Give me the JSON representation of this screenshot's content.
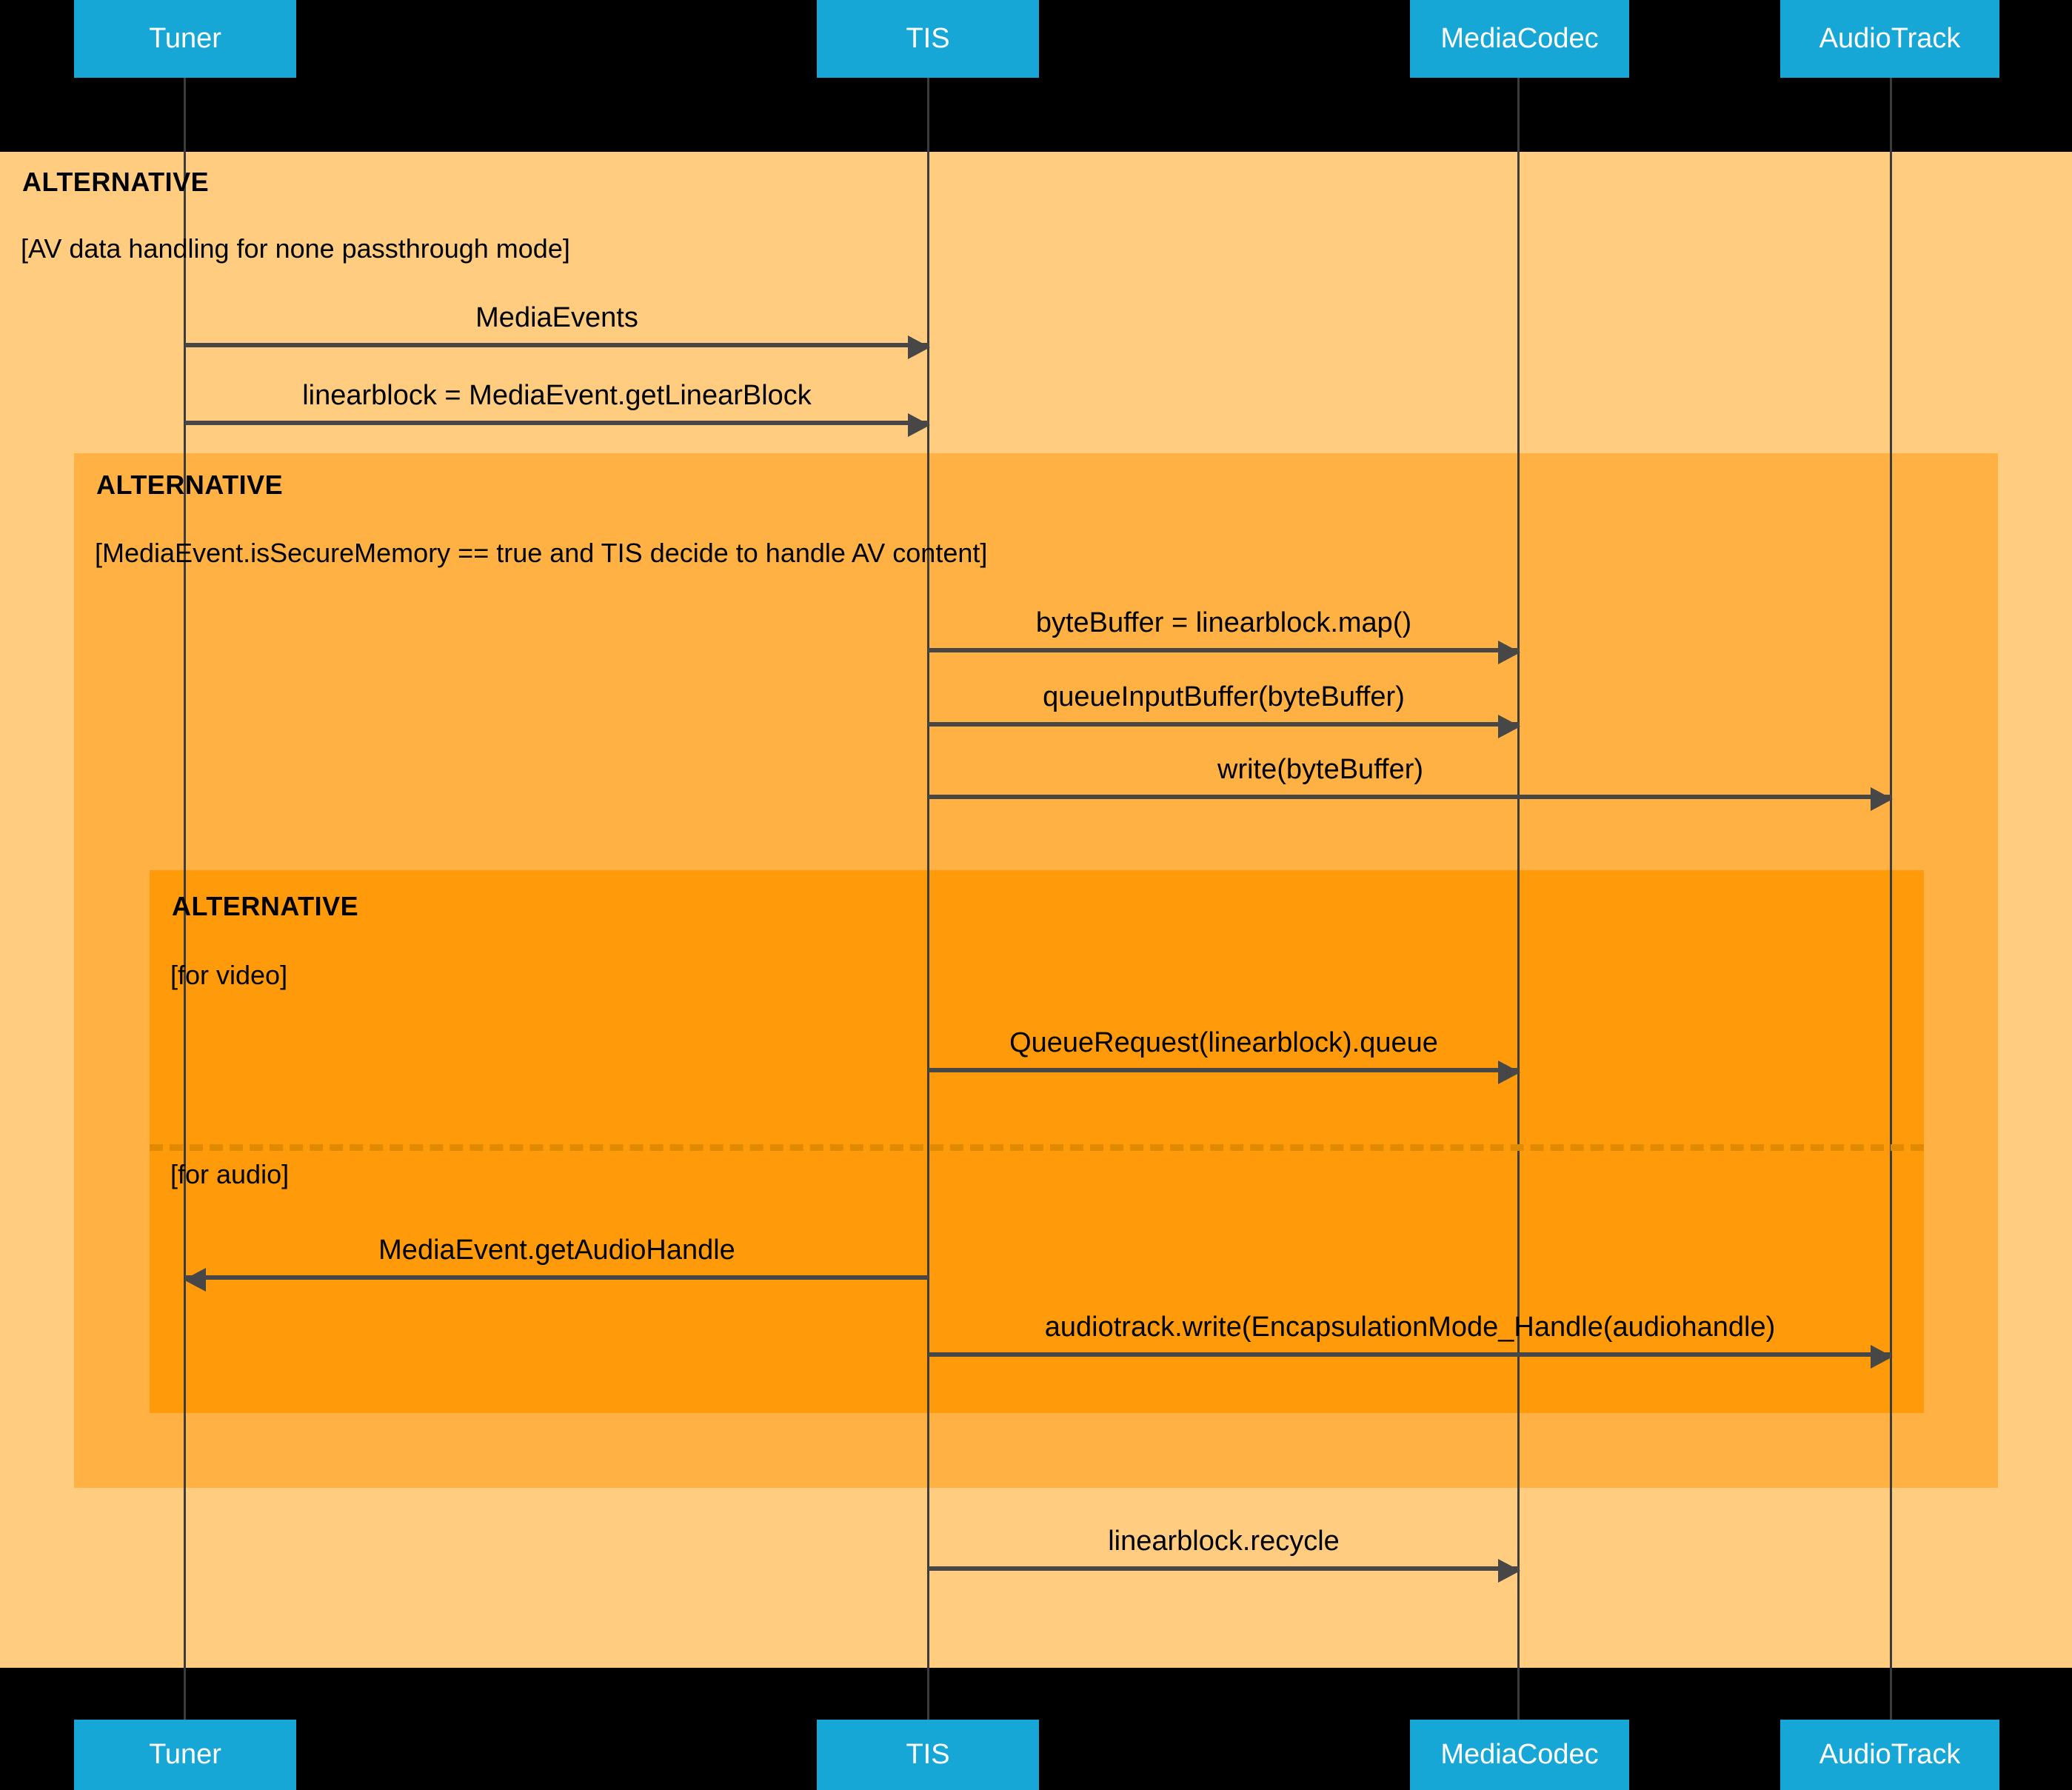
{
  "diagram": {
    "type": "uml-sequence-diagram",
    "background_color": "#000000",
    "participant_color": "#17A7D6",
    "participant_label_color": "#FFFFFF",
    "arrow_color": "#474747"
  },
  "participants": [
    {
      "name": "Tuner"
    },
    {
      "name": "TIS"
    },
    {
      "name": "MediaCodec"
    },
    {
      "name": "AudioTrack"
    }
  ],
  "fragments": {
    "outer": {
      "keyword": "ALTERNATIVE",
      "guard": "[AV data handling for none passthrough mode]",
      "fill": "#FFCC80"
    },
    "middle": {
      "keyword": "ALTERNATIVE",
      "guard": "[MediaEvent.isSecureMemory == true and TIS decide to handle AV content]",
      "fill": "#FFB143"
    },
    "inner": {
      "keyword": "ALTERNATIVE",
      "guard_video": "[for video]",
      "guard_audio": "[for audio]",
      "fill": "#FF9B0A",
      "divider": "dashed"
    }
  },
  "messages": [
    {
      "label": "MediaEvents",
      "from": "Tuner",
      "to": "TIS",
      "direction": "right"
    },
    {
      "label": "linearblock = MediaEvent.getLinearBlock",
      "from": "Tuner",
      "to": "TIS",
      "direction": "right"
    },
    {
      "label": "byteBuffer = linearblock.map()",
      "from": "TIS",
      "to": "MediaCodec",
      "direction": "right"
    },
    {
      "label": "queueInputBuffer(byteBuffer)",
      "from": "TIS",
      "to": "MediaCodec",
      "direction": "right"
    },
    {
      "label": "write(byteBuffer)",
      "from": "TIS",
      "to": "AudioTrack",
      "direction": "right"
    },
    {
      "label": "QueueRequest(linearblock).queue",
      "from": "TIS",
      "to": "MediaCodec",
      "direction": "right"
    },
    {
      "label": "MediaEvent.getAudioHandle",
      "from": "TIS",
      "to": "Tuner",
      "direction": "left"
    },
    {
      "label": "audiotrack.write(EncapsulationMode_Handle(audiohandle)",
      "from": "TIS",
      "to": "AudioTrack",
      "direction": "right"
    },
    {
      "label": "linearblock.recycle",
      "from": "TIS",
      "to": "MediaCodec",
      "direction": "right"
    }
  ]
}
